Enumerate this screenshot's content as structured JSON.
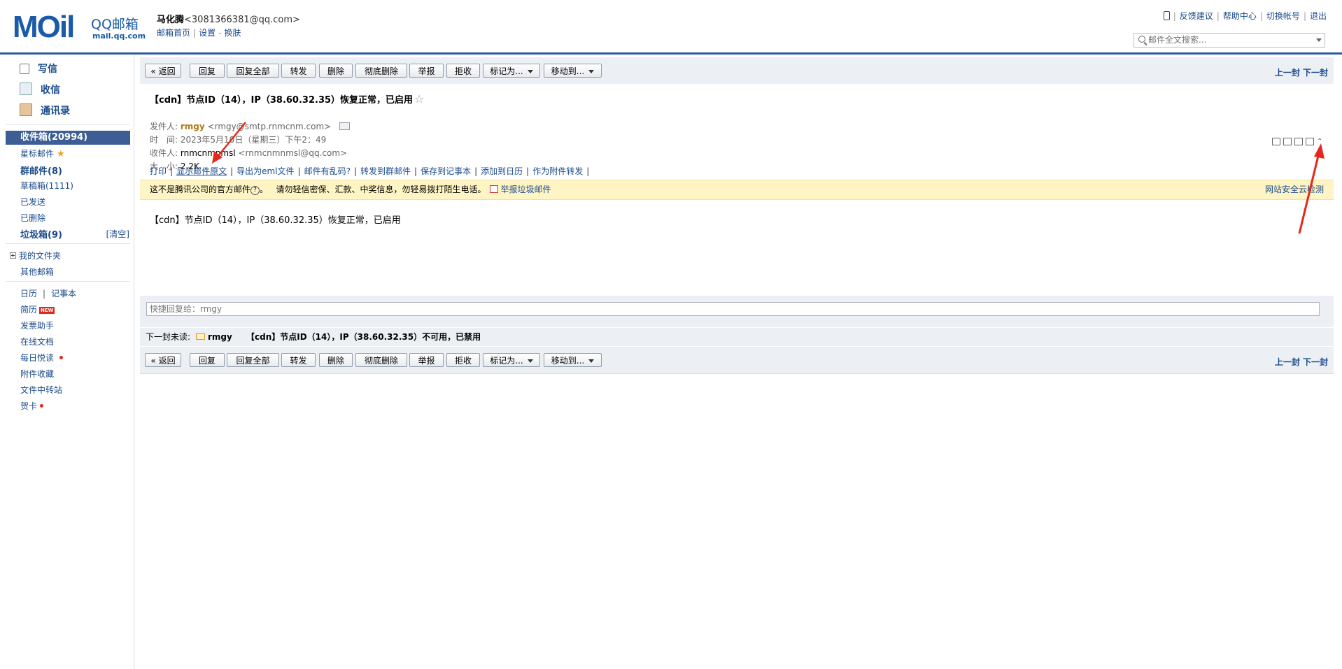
{
  "header": {
    "logo_main": "MOil",
    "logo_title": "QQ邮箱",
    "logo_domain": "mail.qq.com",
    "user_name": "马化腾",
    "user_email": "<3081366381@qq.com>",
    "user_links": [
      "邮箱首页",
      "设置",
      "换肤"
    ],
    "top_links": [
      "反馈建议",
      "帮助中心",
      "切换帐号",
      "退出"
    ],
    "search_placeholder": "邮件全文搜索..."
  },
  "sidebar": {
    "compose": "写信",
    "receive": "收信",
    "contacts": "通讯录",
    "inbox": "收件箱(20994)",
    "starred": "星标邮件",
    "group_mail": "群邮件(8)",
    "drafts": "草稿箱(1111)",
    "sent": "已发送",
    "deleted": "已删除",
    "spam": "垃圾箱(9)",
    "spam_clear": "[清空]",
    "my_folders": "我的文件夹",
    "other_mailboxes": "其他邮箱",
    "calendar": "日历",
    "notepad": "记事本",
    "resume": "简历",
    "new_badge": "NEW",
    "invoice_helper": "发票助手",
    "online_docs": "在线文档",
    "daily_reading": "每日悦读",
    "attachments": "附件收藏",
    "file_transfer": "文件中转站",
    "greeting_cards": "贺卡"
  },
  "toolbar": {
    "back": "« 返回",
    "reply": "回复",
    "reply_all": "回复全部",
    "forward": "转发",
    "delete": "删除",
    "delete_permanent": "彻底删除",
    "report": "举报",
    "reject": "拒收",
    "mark_as": "标记为...",
    "move_to": "移动到...",
    "prev_next": "上一封 下一封"
  },
  "mail": {
    "subject": "【cdn】节点ID（14），IP（38.60.32.35）恢复正常，已启用",
    "sender_label": "发件人:",
    "sender_name": "rmgy",
    "sender_addr": "<rmgy@smtp.rnmcnm.com>",
    "time_label": "时　间:",
    "time_value": "2023年5月10日（星期三）下午2：49",
    "recipient_label": "收件人:",
    "recipient_name": "rnmcnmnmsl",
    "recipient_addr": "<rnmcnmnmsl@qq.com>",
    "size_label": "大　小:",
    "size_value": "2.2K",
    "actions": [
      "打印",
      "显示邮件原文",
      "导出为eml文件",
      "邮件有乱码?",
      "转发到群邮件",
      "保存到记事本",
      "添加到日历",
      "作为附件转发"
    ],
    "warning_text": "这不是腾讯公司的官方邮件",
    "warning_detail": "请勿轻信密保、汇款、中奖信息，勿轻易拨打陌生电话。",
    "warning_report": "举报垃圾邮件",
    "warning_right": "网站安全云检测",
    "body": "【cdn】节点ID（14），IP（38.60.32.35）恢复正常，已启用",
    "quick_reply_placeholder": "快捷回复给：rmgy"
  },
  "next_unread": {
    "label": "下一封未读:",
    "from": "rmgy",
    "subject": "【cdn】节点ID（14），IP（38.60.32.35）不可用，已禁用"
  },
  "colors": {
    "brand_blue": "#1a5aa8",
    "top_bar": "#2e5aa0",
    "inbox_selected": "#3c5e95",
    "warning_bg": "#fff4c3",
    "annotation_red": "#e4281b"
  },
  "icons": [
    "mobile-phone-icon",
    "search-icon",
    "compose-icon",
    "receive-icon",
    "contacts-icon",
    "star-icon",
    "business-card-icon",
    "question-icon",
    "report-flag-icon",
    "envelope-icon"
  ]
}
